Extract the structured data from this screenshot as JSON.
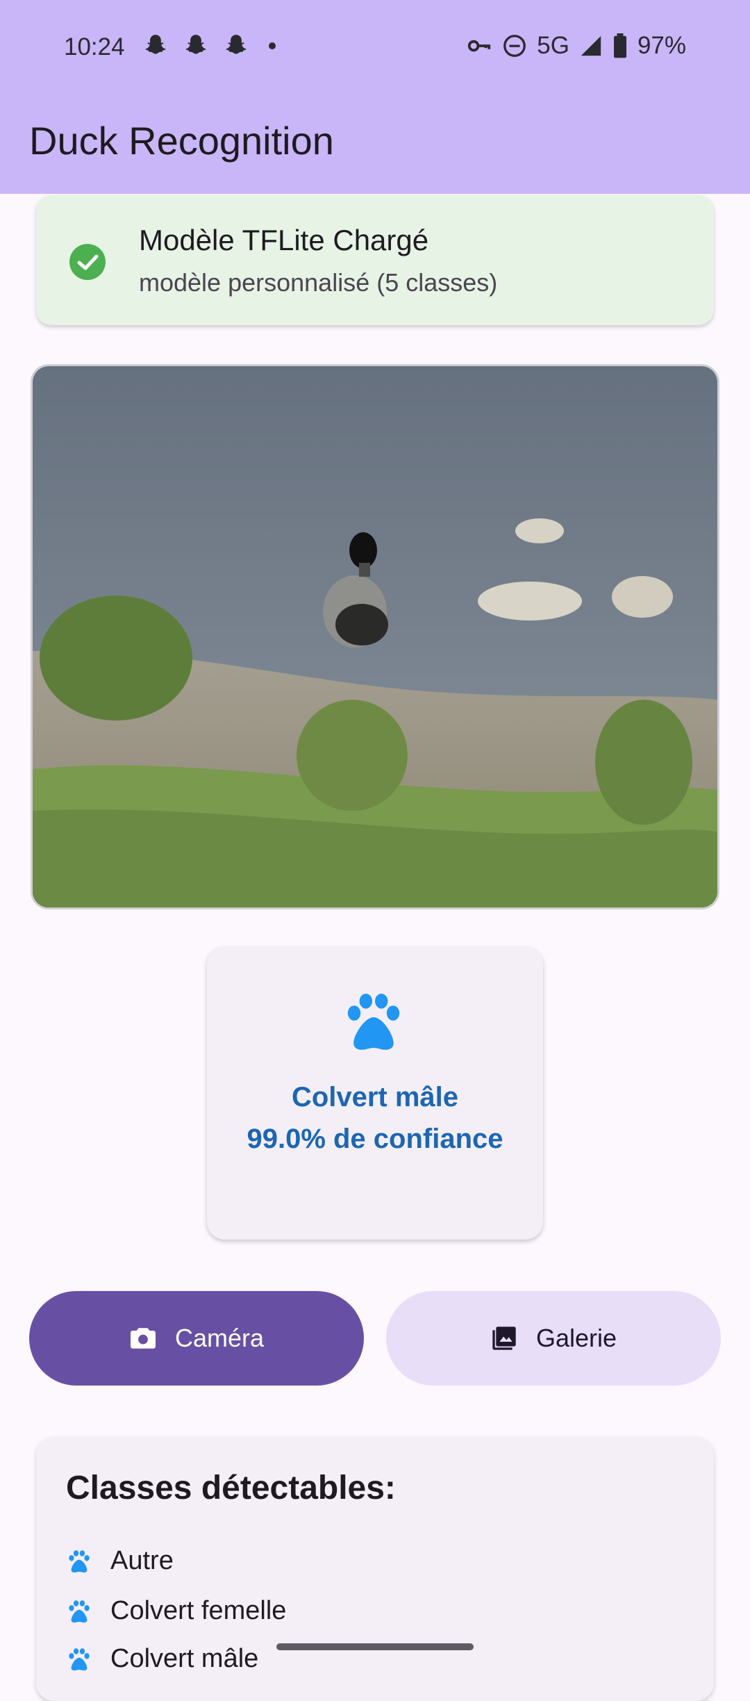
{
  "status_bar": {
    "time": "10:24",
    "network": "5G",
    "battery": "97%"
  },
  "app": {
    "title": "Duck Recognition"
  },
  "model_status": {
    "title": "Modèle TFLite Chargé",
    "subtitle": "modèle personnalisé (5 classes)"
  },
  "result": {
    "label": "Colvert mâle",
    "confidence": "99.0% de confiance"
  },
  "buttons": {
    "camera": "Caméra",
    "gallery": "Galerie"
  },
  "classes": {
    "heading": "Classes détectables:",
    "items": [
      "Autre",
      "Colvert femelle",
      "Colvert mâle"
    ]
  },
  "colors": {
    "accent": "#6750a4",
    "appbar": "#c8b6f8",
    "success": "#4caf50",
    "result": "#1c66b4"
  },
  "icons": [
    "snapchat-icon",
    "vpn-key-icon",
    "dnd-icon",
    "signal-icon",
    "battery-icon",
    "check-circle-icon",
    "paw-icon",
    "camera-icon",
    "gallery-icon"
  ]
}
